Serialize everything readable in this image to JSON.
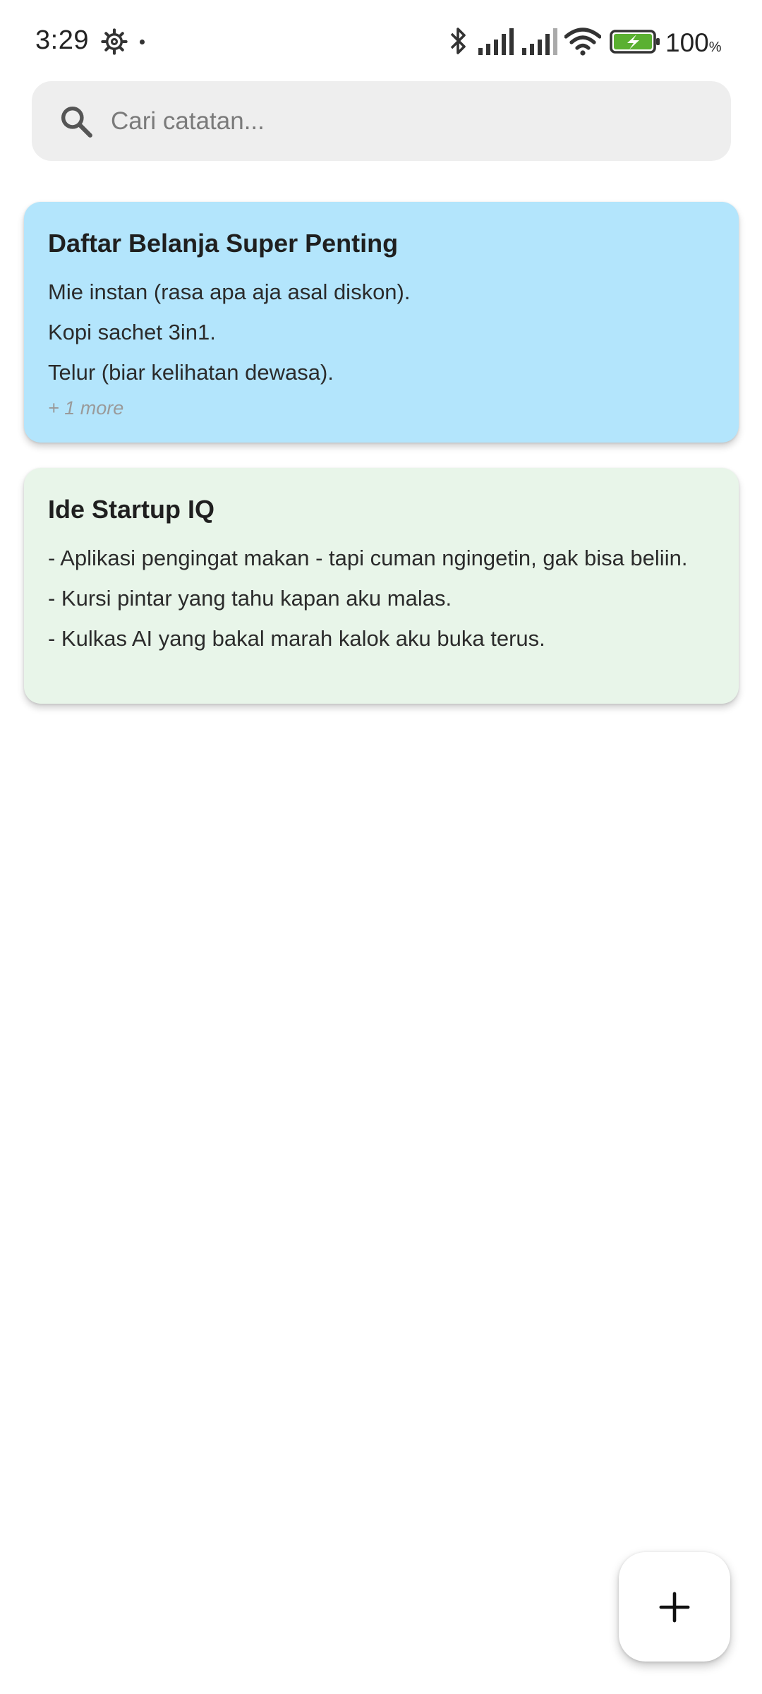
{
  "status_bar": {
    "time": "3:29",
    "battery_percent": "100",
    "battery_unit": "%",
    "icons": [
      "settings-gear-icon",
      "notification-dot-icon",
      "bluetooth-icon",
      "signal-icon",
      "signal-icon",
      "wifi-icon",
      "battery-charging-icon"
    ]
  },
  "search": {
    "placeholder": "Cari catatan...",
    "value": "",
    "icon": "search-icon"
  },
  "notes": [
    {
      "title": "Daftar Belanja Super Penting",
      "color": "#b3e5fc",
      "lines": [
        "Mie instan (rasa apa aja asal diskon).",
        "Kopi sachet 3in1.",
        "Telur (biar kelihatan dewasa)."
      ],
      "more": "+ 1 more"
    },
    {
      "title": "Ide Startup IQ",
      "color": "#e8f5e9",
      "lines": [
        "- Aplikasi pengingat makan - tapi cuman ngingetin, gak bisa beliin.",
        "- Kursi pintar yang tahu kapan aku malas.",
        "- Kulkas AI yang bakal marah kalok aku buka terus."
      ]
    }
  ],
  "fab": {
    "icon": "plus-icon"
  }
}
